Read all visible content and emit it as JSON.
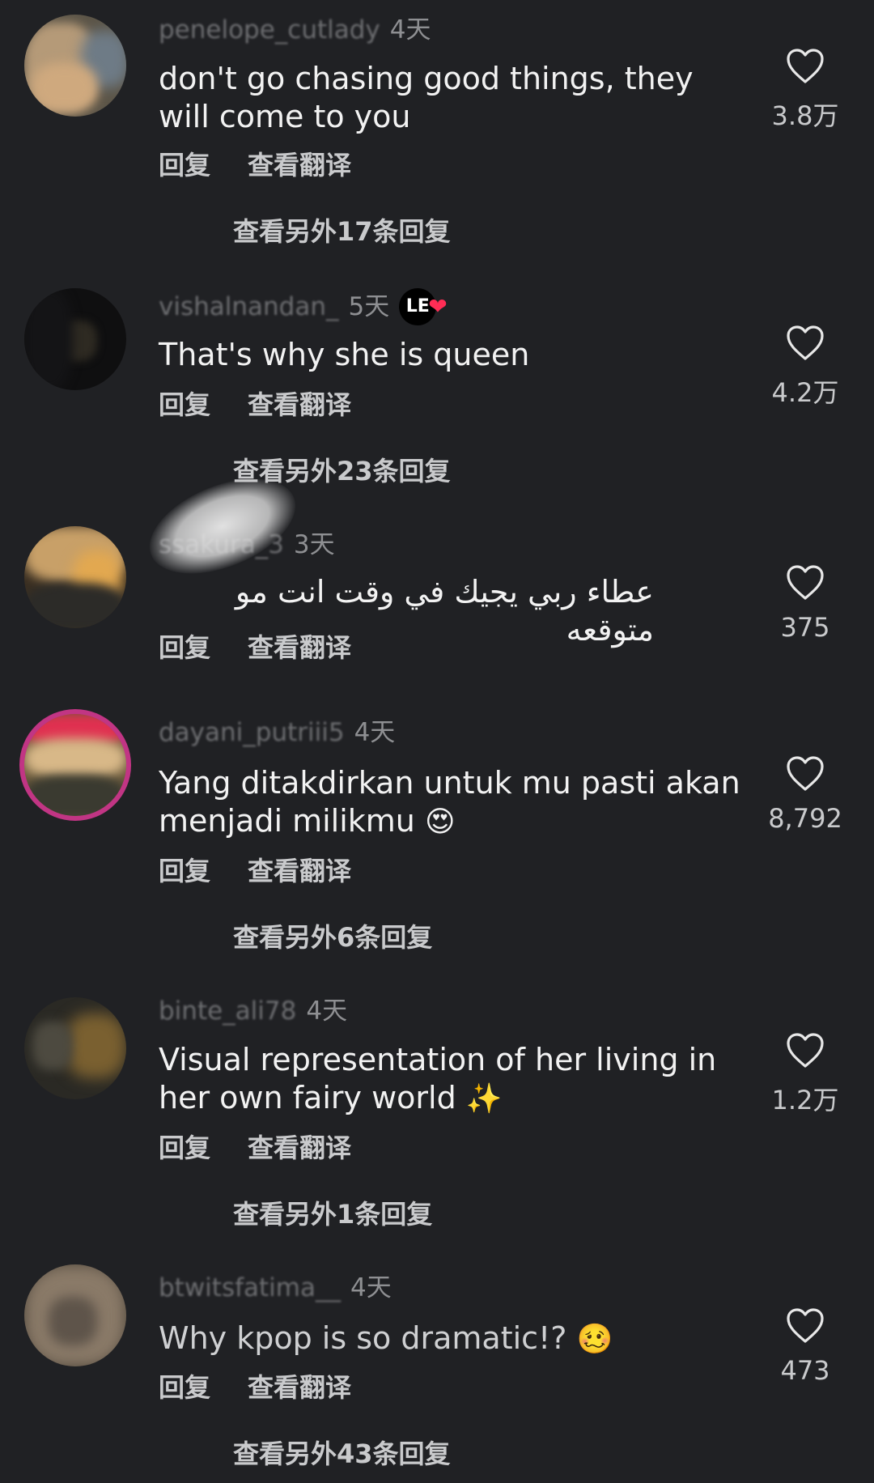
{
  "comments": [
    {
      "username": "penelope_cutlady",
      "time": "4天",
      "text": "don't go chasing good things, they will come to you",
      "reply_label": "回复",
      "translate_label": "查看翻译",
      "likes": "3.8万",
      "more_replies": "查看另外17条回复"
    },
    {
      "username": "vishalnandan_",
      "time": "5天",
      "badge_text": "LE",
      "badge_heart": "❤",
      "text": "That's why she is queen",
      "reply_label": "回复",
      "translate_label": "查看翻译",
      "likes": "4.2万",
      "more_replies": "查看另外23条回复"
    },
    {
      "username": "ssakura_3",
      "time": "3天",
      "text": "عطاء ربي يجيك في وقت انت مو متوقعه",
      "reply_label": "回复",
      "translate_label": "查看翻译",
      "likes": "375"
    },
    {
      "username": "dayani_putriii5",
      "time": "4天",
      "text": "Yang ditakdirkan untuk mu pasti akan menjadi milikmu",
      "emoji": "😍",
      "reply_label": "回复",
      "translate_label": "查看翻译",
      "likes": "8,792",
      "more_replies": "查看另外6条回复"
    },
    {
      "username": "binte_ali78",
      "time": "4天",
      "text": "Visual representation of her living in her own fairy world",
      "emoji": "✨",
      "reply_label": "回复",
      "translate_label": "查看翻译",
      "likes": "1.2万",
      "more_replies": "查看另外1条回复"
    },
    {
      "username": "btwitsfatima__",
      "time": "4天",
      "text": "Why kpop is so dramatic!?",
      "emoji": "🥴",
      "reply_label": "回复",
      "translate_label": "查看翻译",
      "likes": "473",
      "more_replies": "查看另外43条回复"
    }
  ],
  "icons": {
    "like": "heart-outline-icon"
  },
  "colors": {
    "background": "#202124",
    "text": "#f2f2f2",
    "muted": "#8e8f92",
    "action": "#c9cacc",
    "badge_heart": "#ff2d55",
    "avatar_ring": "#c13584"
  }
}
